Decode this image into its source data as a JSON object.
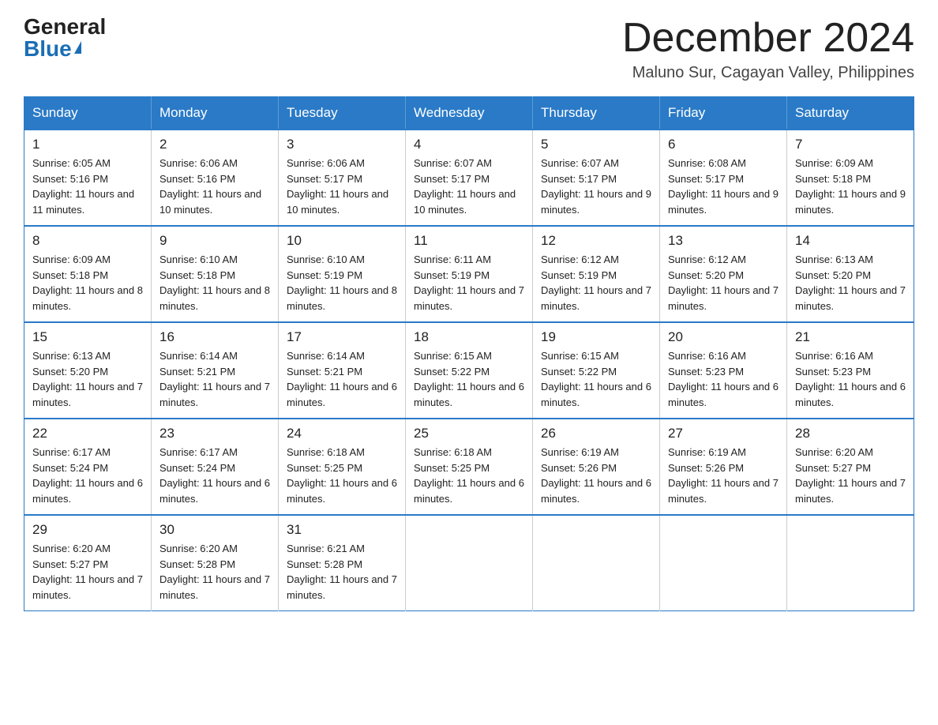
{
  "header": {
    "logo_general": "General",
    "logo_blue": "Blue",
    "month_title": "December 2024",
    "location": "Maluno Sur, Cagayan Valley, Philippines"
  },
  "days_of_week": [
    "Sunday",
    "Monday",
    "Tuesday",
    "Wednesday",
    "Thursday",
    "Friday",
    "Saturday"
  ],
  "weeks": [
    [
      {
        "day": "1",
        "sunrise": "6:05 AM",
        "sunset": "5:16 PM",
        "daylight": "11 hours and 11 minutes."
      },
      {
        "day": "2",
        "sunrise": "6:06 AM",
        "sunset": "5:16 PM",
        "daylight": "11 hours and 10 minutes."
      },
      {
        "day": "3",
        "sunrise": "6:06 AM",
        "sunset": "5:17 PM",
        "daylight": "11 hours and 10 minutes."
      },
      {
        "day": "4",
        "sunrise": "6:07 AM",
        "sunset": "5:17 PM",
        "daylight": "11 hours and 10 minutes."
      },
      {
        "day": "5",
        "sunrise": "6:07 AM",
        "sunset": "5:17 PM",
        "daylight": "11 hours and 9 minutes."
      },
      {
        "day": "6",
        "sunrise": "6:08 AM",
        "sunset": "5:17 PM",
        "daylight": "11 hours and 9 minutes."
      },
      {
        "day": "7",
        "sunrise": "6:09 AM",
        "sunset": "5:18 PM",
        "daylight": "11 hours and 9 minutes."
      }
    ],
    [
      {
        "day": "8",
        "sunrise": "6:09 AM",
        "sunset": "5:18 PM",
        "daylight": "11 hours and 8 minutes."
      },
      {
        "day": "9",
        "sunrise": "6:10 AM",
        "sunset": "5:18 PM",
        "daylight": "11 hours and 8 minutes."
      },
      {
        "day": "10",
        "sunrise": "6:10 AM",
        "sunset": "5:19 PM",
        "daylight": "11 hours and 8 minutes."
      },
      {
        "day": "11",
        "sunrise": "6:11 AM",
        "sunset": "5:19 PM",
        "daylight": "11 hours and 7 minutes."
      },
      {
        "day": "12",
        "sunrise": "6:12 AM",
        "sunset": "5:19 PM",
        "daylight": "11 hours and 7 minutes."
      },
      {
        "day": "13",
        "sunrise": "6:12 AM",
        "sunset": "5:20 PM",
        "daylight": "11 hours and 7 minutes."
      },
      {
        "day": "14",
        "sunrise": "6:13 AM",
        "sunset": "5:20 PM",
        "daylight": "11 hours and 7 minutes."
      }
    ],
    [
      {
        "day": "15",
        "sunrise": "6:13 AM",
        "sunset": "5:20 PM",
        "daylight": "11 hours and 7 minutes."
      },
      {
        "day": "16",
        "sunrise": "6:14 AM",
        "sunset": "5:21 PM",
        "daylight": "11 hours and 7 minutes."
      },
      {
        "day": "17",
        "sunrise": "6:14 AM",
        "sunset": "5:21 PM",
        "daylight": "11 hours and 6 minutes."
      },
      {
        "day": "18",
        "sunrise": "6:15 AM",
        "sunset": "5:22 PM",
        "daylight": "11 hours and 6 minutes."
      },
      {
        "day": "19",
        "sunrise": "6:15 AM",
        "sunset": "5:22 PM",
        "daylight": "11 hours and 6 minutes."
      },
      {
        "day": "20",
        "sunrise": "6:16 AM",
        "sunset": "5:23 PM",
        "daylight": "11 hours and 6 minutes."
      },
      {
        "day": "21",
        "sunrise": "6:16 AM",
        "sunset": "5:23 PM",
        "daylight": "11 hours and 6 minutes."
      }
    ],
    [
      {
        "day": "22",
        "sunrise": "6:17 AM",
        "sunset": "5:24 PM",
        "daylight": "11 hours and 6 minutes."
      },
      {
        "day": "23",
        "sunrise": "6:17 AM",
        "sunset": "5:24 PM",
        "daylight": "11 hours and 6 minutes."
      },
      {
        "day": "24",
        "sunrise": "6:18 AM",
        "sunset": "5:25 PM",
        "daylight": "11 hours and 6 minutes."
      },
      {
        "day": "25",
        "sunrise": "6:18 AM",
        "sunset": "5:25 PM",
        "daylight": "11 hours and 6 minutes."
      },
      {
        "day": "26",
        "sunrise": "6:19 AM",
        "sunset": "5:26 PM",
        "daylight": "11 hours and 6 minutes."
      },
      {
        "day": "27",
        "sunrise": "6:19 AM",
        "sunset": "5:26 PM",
        "daylight": "11 hours and 7 minutes."
      },
      {
        "day": "28",
        "sunrise": "6:20 AM",
        "sunset": "5:27 PM",
        "daylight": "11 hours and 7 minutes."
      }
    ],
    [
      {
        "day": "29",
        "sunrise": "6:20 AM",
        "sunset": "5:27 PM",
        "daylight": "11 hours and 7 minutes."
      },
      {
        "day": "30",
        "sunrise": "6:20 AM",
        "sunset": "5:28 PM",
        "daylight": "11 hours and 7 minutes."
      },
      {
        "day": "31",
        "sunrise": "6:21 AM",
        "sunset": "5:28 PM",
        "daylight": "11 hours and 7 minutes."
      },
      null,
      null,
      null,
      null
    ]
  ]
}
